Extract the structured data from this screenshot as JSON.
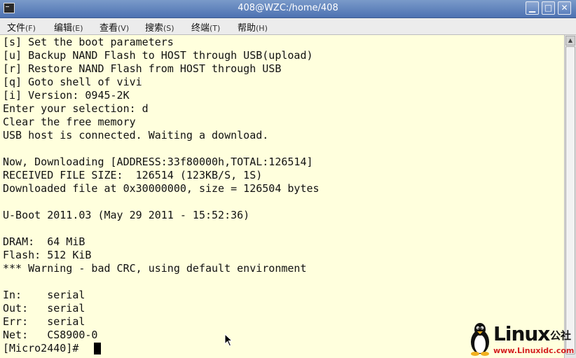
{
  "window": {
    "title": "408@WZC:/home/408"
  },
  "menu": [
    {
      "label": "文件",
      "accel": "(F)"
    },
    {
      "label": "编辑",
      "accel": "(E)"
    },
    {
      "label": "查看",
      "accel": "(V)"
    },
    {
      "label": "搜索",
      "accel": "(S)"
    },
    {
      "label": "终端",
      "accel": "(T)"
    },
    {
      "label": "帮助",
      "accel": "(H)"
    }
  ],
  "terminal": {
    "lines": [
      "[s] Set the boot parameters",
      "[u] Backup NAND Flash to HOST through USB(upload)",
      "[r] Restore NAND Flash from HOST through USB",
      "[q] Goto shell of vivi",
      "[i] Version: 0945-2K",
      "Enter your selection: d",
      "Clear the free memory",
      "USB host is connected. Waiting a download.",
      "",
      "Now, Downloading [ADDRESS:33f80000h,TOTAL:126514]",
      "RECEIVED FILE SIZE:  126514 (123KB/S, 1S)",
      "Downloaded file at 0x30000000, size = 126504 bytes",
      "",
      "U-Boot 2011.03 (May 29 2011 - 15:52:36)",
      "",
      "DRAM:  64 MiB",
      "Flash: 512 KiB",
      "*** Warning - bad CRC, using default environment",
      "",
      "In:    serial",
      "Out:   serial",
      "Err:   serial",
      "Net:   CS8900-0",
      "[Micro2440]# "
    ]
  },
  "watermark": {
    "word": "Linux",
    "cn": "公社",
    "url": "www.Linuxidc.com"
  }
}
